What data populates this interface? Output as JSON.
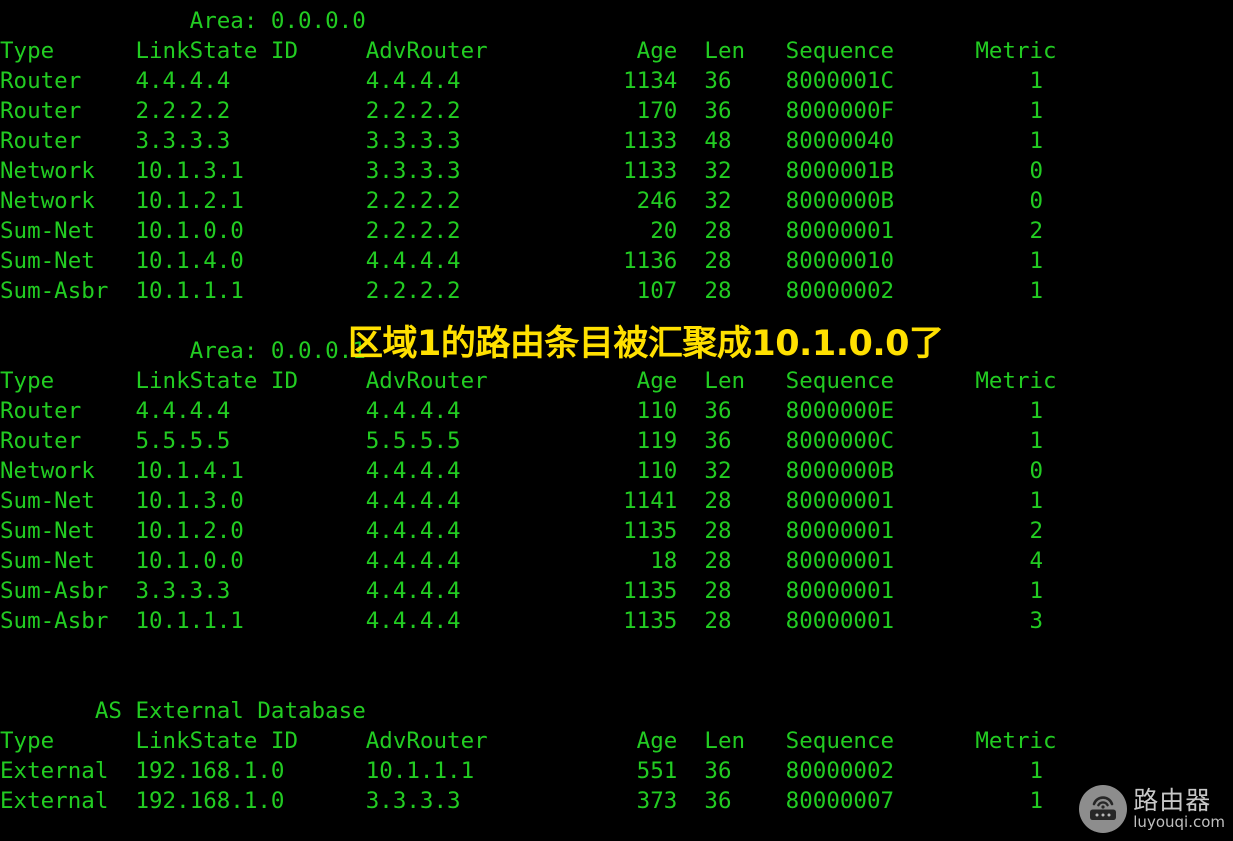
{
  "terminal": {
    "fg_color": "#22cc22",
    "bg_color": "#000000",
    "lines": [
      "              Area: 0.0.0.0",
      "Type      LinkState ID     AdvRouter           Age  Len   Sequence      Metric",
      "Router    4.4.4.4          4.4.4.4            1134  36    8000001C          1",
      "Router    2.2.2.2          2.2.2.2             170  36    8000000F          1",
      "Router    3.3.3.3          3.3.3.3            1133  48    80000040          1",
      "Network   10.1.3.1         3.3.3.3            1133  32    8000001B          0",
      "Network   10.1.2.1         2.2.2.2             246  32    8000000B          0",
      "Sum-Net   10.1.0.0         2.2.2.2              20  28    80000001          2",
      "Sum-Net   10.1.4.0         4.4.4.4            1136  28    80000010          1",
      "Sum-Asbr  10.1.1.1         2.2.2.2             107  28    80000002          1",
      "",
      "              Area: 0.0.0.1",
      "Type      LinkState ID     AdvRouter           Age  Len   Sequence      Metric",
      "Router    4.4.4.4          4.4.4.4             110  36    8000000E          1",
      "Router    5.5.5.5          5.5.5.5             119  36    8000000C          1",
      "Network   10.1.4.1         4.4.4.4             110  32    8000000B          0",
      "Sum-Net   10.1.3.0         4.4.4.4            1141  28    80000001          1",
      "Sum-Net   10.1.2.0         4.4.4.4            1135  28    80000001          2",
      "Sum-Net   10.1.0.0         4.4.4.4              18  28    80000001          4",
      "Sum-Asbr  3.3.3.3          4.4.4.4            1135  28    80000001          1",
      "Sum-Asbr  10.1.1.1         4.4.4.4            1135  28    80000001          3",
      "",
      "",
      "       AS External Database",
      "Type      LinkState ID     AdvRouter           Age  Len   Sequence      Metric",
      "External  192.168.1.0      10.1.1.1            551  36    80000002          1",
      "External  192.168.1.0      3.3.3.3             373  36    80000007          1"
    ]
  },
  "areas": [
    {
      "heading": "Area: 0.0.0.0",
      "columns": [
        "Type",
        "LinkState ID",
        "AdvRouter",
        "Age",
        "Len",
        "Sequence",
        "Metric"
      ],
      "rows": [
        [
          "Router",
          "4.4.4.4",
          "4.4.4.4",
          "1134",
          "36",
          "8000001C",
          "1"
        ],
        [
          "Router",
          "2.2.2.2",
          "2.2.2.2",
          "170",
          "36",
          "8000000F",
          "1"
        ],
        [
          "Router",
          "3.3.3.3",
          "3.3.3.3",
          "1133",
          "48",
          "80000040",
          "1"
        ],
        [
          "Network",
          "10.1.3.1",
          "3.3.3.3",
          "1133",
          "32",
          "8000001B",
          "0"
        ],
        [
          "Network",
          "10.1.2.1",
          "2.2.2.2",
          "246",
          "32",
          "8000000B",
          "0"
        ],
        [
          "Sum-Net",
          "10.1.0.0",
          "2.2.2.2",
          "20",
          "28",
          "80000001",
          "2"
        ],
        [
          "Sum-Net",
          "10.1.4.0",
          "4.4.4.4",
          "1136",
          "28",
          "80000010",
          "1"
        ],
        [
          "Sum-Asbr",
          "10.1.1.1",
          "2.2.2.2",
          "107",
          "28",
          "80000002",
          "1"
        ]
      ]
    },
    {
      "heading": "Area: 0.0.0.1",
      "columns": [
        "Type",
        "LinkState ID",
        "AdvRouter",
        "Age",
        "Len",
        "Sequence",
        "Metric"
      ],
      "rows": [
        [
          "Router",
          "4.4.4.4",
          "4.4.4.4",
          "110",
          "36",
          "8000000E",
          "1"
        ],
        [
          "Router",
          "5.5.5.5",
          "5.5.5.5",
          "119",
          "36",
          "8000000C",
          "1"
        ],
        [
          "Network",
          "10.1.4.1",
          "4.4.4.4",
          "110",
          "32",
          "8000000B",
          "0"
        ],
        [
          "Sum-Net",
          "10.1.3.0",
          "4.4.4.4",
          "1141",
          "28",
          "80000001",
          "1"
        ],
        [
          "Sum-Net",
          "10.1.2.0",
          "4.4.4.4",
          "1135",
          "28",
          "80000001",
          "2"
        ],
        [
          "Sum-Net",
          "10.1.0.0",
          "4.4.4.4",
          "18",
          "28",
          "80000001",
          "4"
        ],
        [
          "Sum-Asbr",
          "3.3.3.3",
          "4.4.4.4",
          "1135",
          "28",
          "80000001",
          "1"
        ],
        [
          "Sum-Asbr",
          "10.1.1.1",
          "4.4.4.4",
          "1135",
          "28",
          "80000001",
          "3"
        ]
      ]
    },
    {
      "heading": "AS External Database",
      "columns": [
        "Type",
        "LinkState ID",
        "AdvRouter",
        "Age",
        "Len",
        "Sequence",
        "Metric"
      ],
      "rows": [
        [
          "External",
          "192.168.1.0",
          "10.1.1.1",
          "551",
          "36",
          "80000002",
          "1"
        ],
        [
          "External",
          "192.168.1.0",
          "3.3.3.3",
          "373",
          "36",
          "80000007",
          "1"
        ]
      ]
    }
  ],
  "annotation": {
    "text": "区域1的路由条目被汇聚成10.1.0.0了",
    "color": "#ffe000"
  },
  "watermark": {
    "icon": "router-icon",
    "name": "路由器",
    "url": "luyouqi.com"
  }
}
